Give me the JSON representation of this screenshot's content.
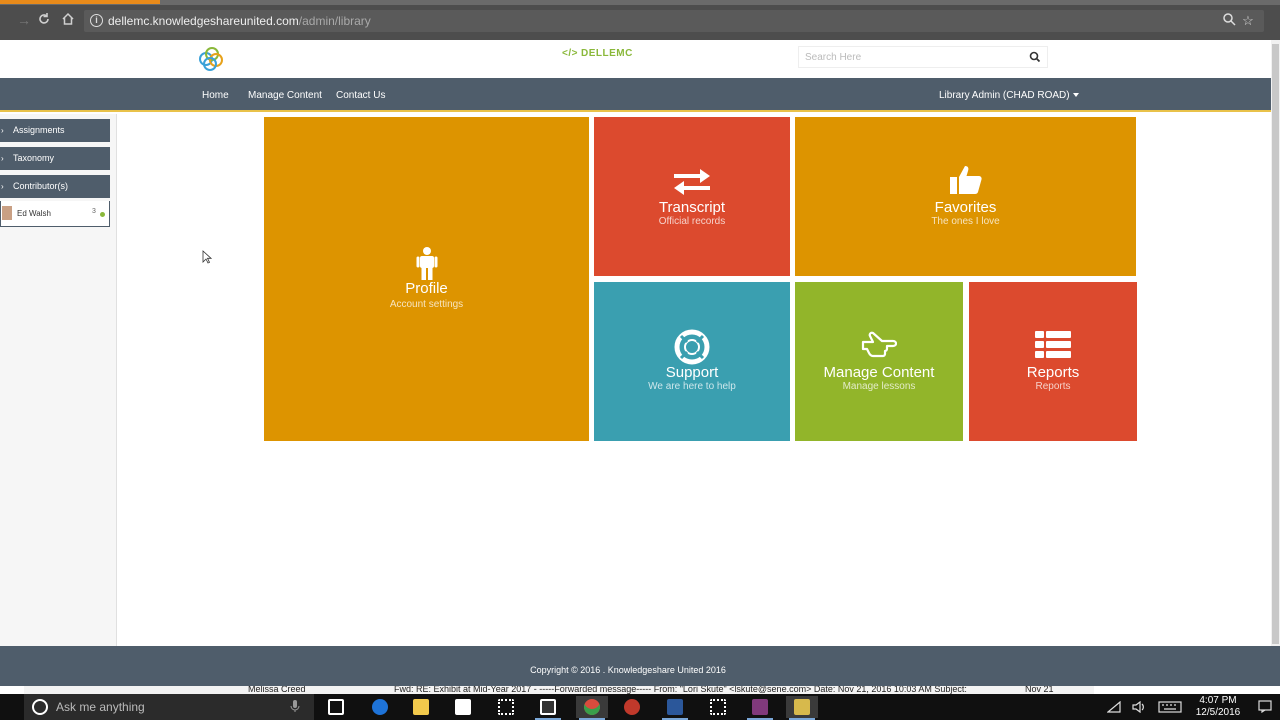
{
  "browser": {
    "url_host": "dellemc.knowledgeshareunited.com",
    "url_path": "/admin/library"
  },
  "header": {
    "brand": "DELLEMC",
    "search_placeholder": "Search Here"
  },
  "nav": {
    "links": [
      "Home",
      "Manage Content",
      "Contact Us"
    ],
    "user": "Library Admin (CHAD ROAD)"
  },
  "sidebar": {
    "items": [
      "Assignments",
      "Taxonomy",
      "Contributor(s)"
    ],
    "contributor": {
      "name": "Ed Walsh",
      "count": "3"
    }
  },
  "tiles": {
    "profile": {
      "title": "Profile",
      "subtitle": "Account settings",
      "color": "#dd9400"
    },
    "transcript": {
      "title": "Transcript",
      "subtitle": "Official records",
      "color": "#dc4a2e"
    },
    "favorites": {
      "title": "Favorites",
      "subtitle": "The ones I love",
      "color": "#dd9400"
    },
    "support": {
      "title": "Support",
      "subtitle": "We are here to help",
      "color": "#3a9fb0"
    },
    "manage": {
      "title": "Manage Content",
      "subtitle": "Manage lessons",
      "color": "#92b52a"
    },
    "reports": {
      "title": "Reports",
      "subtitle": "Reports",
      "color": "#dc4a2e"
    }
  },
  "footer": {
    "copyright": "Copyright © 2016 . Knowledgeshare United 2016"
  },
  "outlook_preview": {
    "sender": "Melissa Creed",
    "message": "Fwd: RE: Exhibit at Mid-Year 2017 - -----Forwarded message----- From: \"Lori Skute\" <lskute@sene.com> Date: Nov 21, 2016 10:03 AM Subject:",
    "date": "Nov 21"
  },
  "taskbar": {
    "search_text": "Ask me anything",
    "time": "4:07 PM",
    "date": "12/5/2016"
  }
}
